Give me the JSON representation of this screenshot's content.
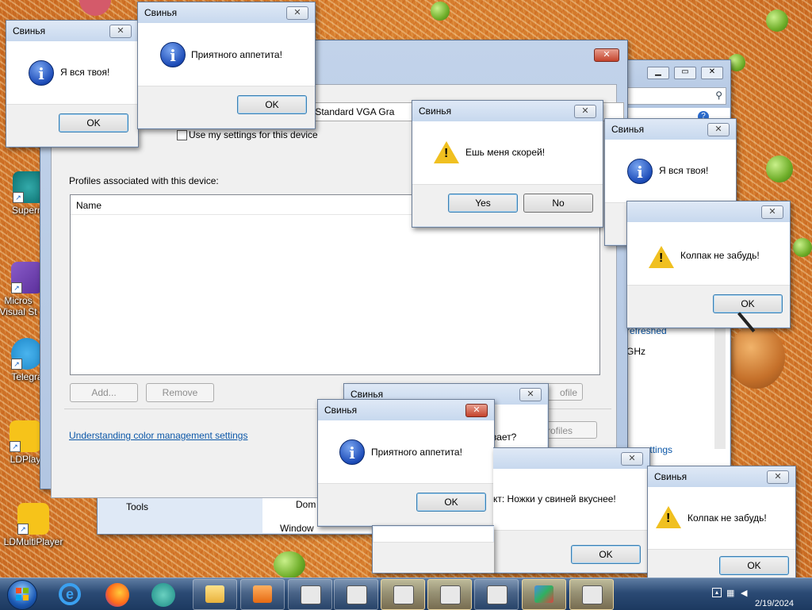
{
  "desktop": {
    "icons": [
      {
        "label": "Superm",
        "icon": "superm-icon"
      },
      {
        "label": "Micros Visual St",
        "icon": "visual-studio-icon"
      },
      {
        "label": "Telegra",
        "icon": "telegram-icon"
      },
      {
        "label": "LDPlay",
        "icon": "ldplayer-icon"
      },
      {
        "label": "LDMultiPlayer",
        "icon": "ldmultiplayer-icon"
      }
    ]
  },
  "color_mgmt": {
    "device_text": "itor - Standard VGA Gra",
    "use_settings": "Use my settings for this device",
    "profiles_label": "Profiles associated with this device:",
    "col_name": "Name",
    "add": "Add...",
    "remove": "Remove",
    "profile_btn": "ofile",
    "profiles_btn": "rofiles",
    "link": "Understanding color management settings"
  },
  "back_panel": {
    "refreshed": "refreshed",
    "ghz": "GHz",
    "settings_link": "ge settings"
  },
  "control_panel": {
    "perf": "Performance Information and Tools",
    "dom": "Dom",
    "win": "Window"
  },
  "dialogs": {
    "title": "Свинья",
    "ok": "OK",
    "yes": "Yes",
    "no": "No",
    "m1": "Я вся твоя!",
    "m2": "Приятного аппетита!",
    "m3": "Ешь меня скорей!",
    "m4": "Я вся твоя!",
    "m5": "Колпак не забудь!",
    "m6": "вает?",
    "m7": "Приятного аппетита!",
    "m8": "кт: Ножки у свиней вкуснее!",
    "m9": "Колпак не забудь!"
  },
  "tray": {
    "date": "2/19/2024"
  }
}
